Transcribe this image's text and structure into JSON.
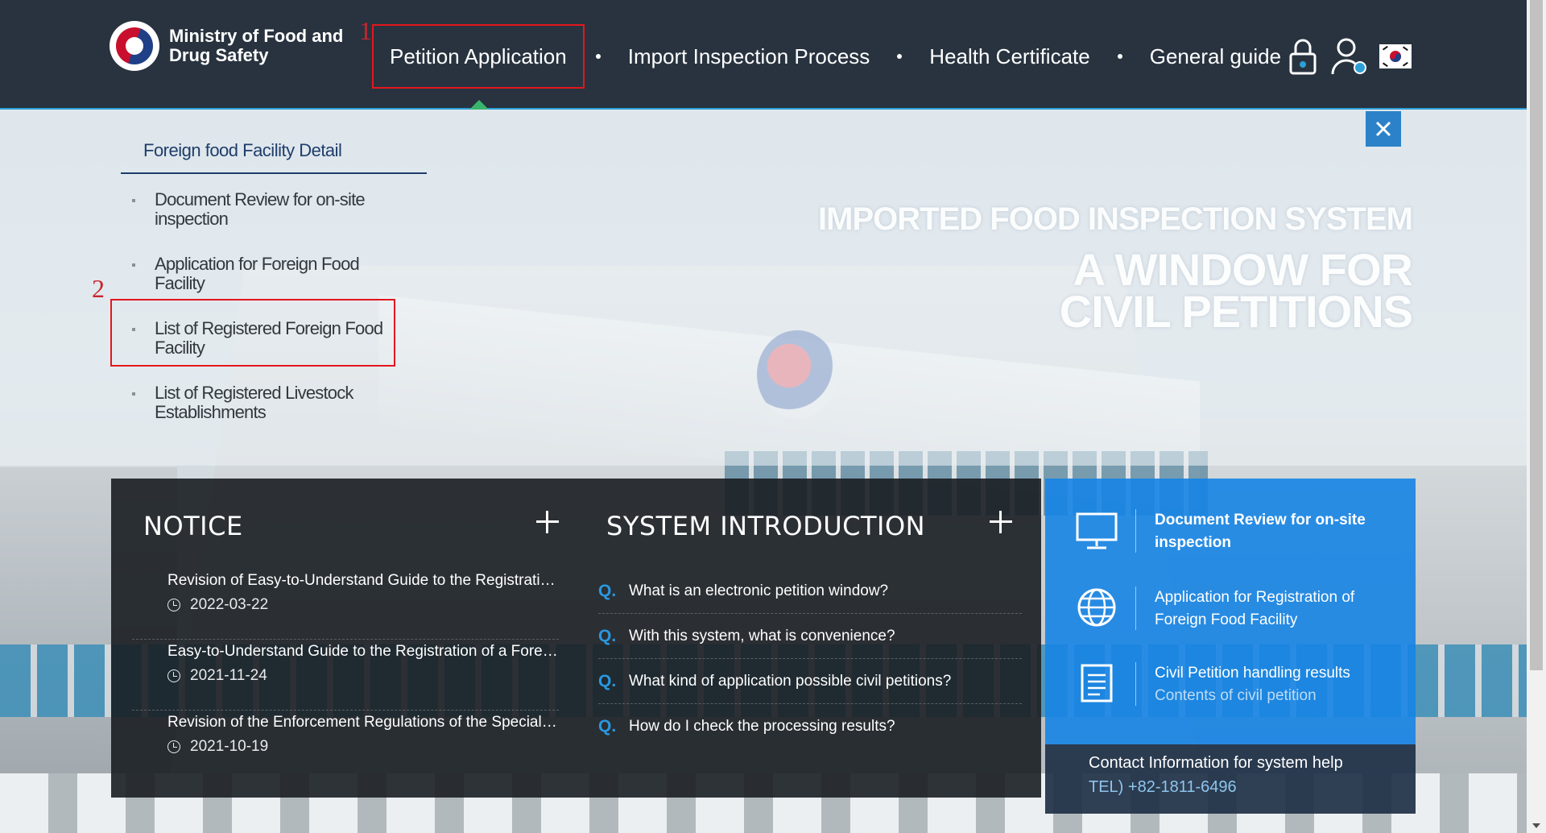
{
  "header": {
    "logo_text": "Ministry of Food and Drug Safety",
    "nav": [
      {
        "label": "Petition Application"
      },
      {
        "label": "Import Inspection Process"
      },
      {
        "label": "Health Certificate"
      },
      {
        "label": "General guide"
      }
    ],
    "icons": [
      "lock-icon",
      "user-icon",
      "korea-flag-icon"
    ]
  },
  "annotations": [
    "1",
    "2"
  ],
  "submenu": {
    "title": "Foreign food Facility Detail",
    "items": [
      {
        "label": "Document Review for on-site inspection"
      },
      {
        "label": "Application for Foreign Food Facility"
      },
      {
        "label": "List of Registered Foreign Food Facility"
      },
      {
        "label": "List of Registered Livestock Establishments"
      }
    ]
  },
  "hero": {
    "subtitle": "IMPORTED FOOD INSPECTION SYSTEM",
    "title": "A WINDOW FOR\nCIVIL PETITIONS"
  },
  "notice": {
    "title": "NOTICE",
    "items": [
      {
        "text": "Revision of Easy-to-Understand Guide to the Registration of a Foreign Food Facility",
        "date": "2022-03-22"
      },
      {
        "text": "Easy-to-Understand Guide to the Registration of a Foreign Food Facility",
        "date": "2021-11-24"
      },
      {
        "text": "Revision of the Enforcement Regulations of the Special Act on Imported Food Safety Control",
        "date": "2021-10-19"
      }
    ]
  },
  "system_intro": {
    "title": "SYSTEM INTRODUCTION",
    "q_label": "Q.",
    "items": [
      {
        "text": "What is an electronic petition window?"
      },
      {
        "text": "With this system, what is convenience?"
      },
      {
        "text": "What kind of application possible civil petitions?"
      },
      {
        "text": "How do I check the processing results?"
      }
    ]
  },
  "quick_links": [
    {
      "label": "Document Review for on-site inspection",
      "sub": "",
      "icon": "monitor-icon"
    },
    {
      "label": "Application for Registration of Foreign Food Facility",
      "sub": "",
      "icon": "globe-icon"
    },
    {
      "label": "Civil Petition handling results",
      "sub": "Contents of civil petition",
      "icon": "document-icon"
    }
  ],
  "contact": {
    "title": "Contact Information for system help",
    "tel": "TEL) +82-1811-6496"
  },
  "colors": {
    "header_bg": "#28333f",
    "accent_blue": "#1684e4",
    "annotation_red": "#e4161e",
    "faq_q": "#2a98e0"
  }
}
